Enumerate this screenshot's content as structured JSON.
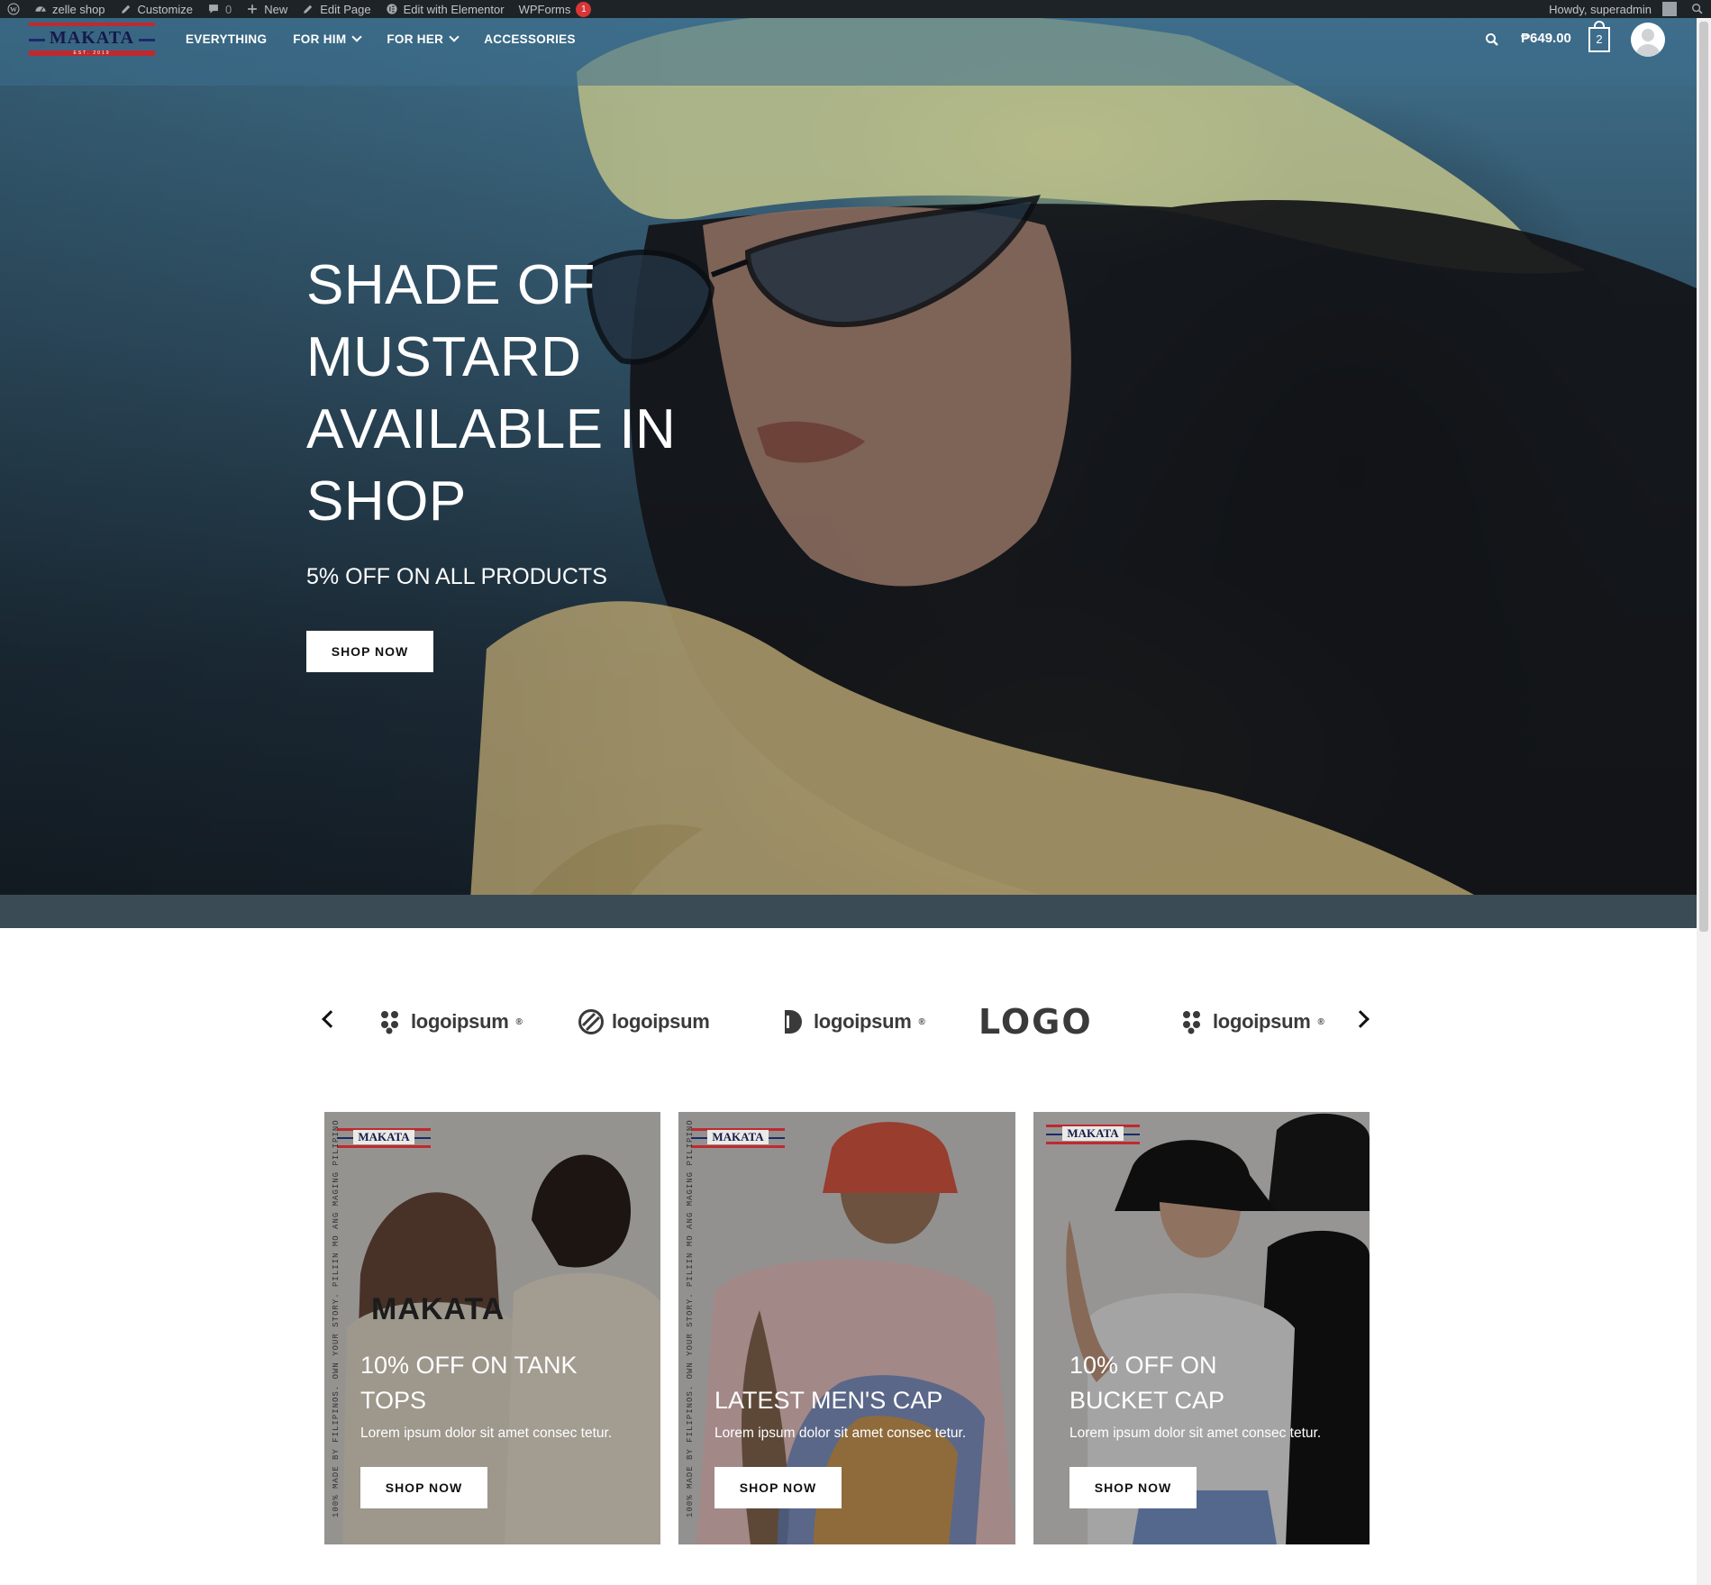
{
  "admin_bar": {
    "site_name": "zelle shop",
    "customize": "Customize",
    "comments_count": "0",
    "new": "New",
    "edit_page": "Edit Page",
    "edit_elementor": "Edit with Elementor",
    "wpforms": "WPForms",
    "wpforms_badge": "1",
    "howdy": "Howdy, superadmin"
  },
  "header": {
    "logo_text": "MAKATA",
    "logo_est": "EST. 2019",
    "nav": [
      {
        "label": "EVERYTHING",
        "has_dropdown": false
      },
      {
        "label": "FOR HIM",
        "has_dropdown": true
      },
      {
        "label": "FOR HER",
        "has_dropdown": true
      },
      {
        "label": "ACCESSORIES",
        "has_dropdown": false
      }
    ],
    "cart_total": "₱649.00",
    "cart_count": "2"
  },
  "hero": {
    "title": "SHADE OF MUSTARD AVAILABLE IN SHOP",
    "subtitle": "5% OFF ON ALL PRODUCTS",
    "button": "SHOP NOW"
  },
  "brands": [
    {
      "name": "logoipsum",
      "icon": "bubbles-logo-icon",
      "suffix": "®"
    },
    {
      "name": "logoipsum",
      "icon": "circle-stripes-logo-icon",
      "suffix": ""
    },
    {
      "name": "logoipsum",
      "icon": "half-circle-logo-icon",
      "suffix": "®"
    },
    {
      "name": "LOGO",
      "icon": "square-logo-icon",
      "suffix": ""
    },
    {
      "name": "logoipsum",
      "icon": "bubbles-logo-icon",
      "suffix": "®"
    }
  ],
  "cards": [
    {
      "title": "10% OFF ON TANK TOPS",
      "desc": "Lorem ipsum dolor sit amet consec tetur.",
      "button": "SHOP NOW",
      "logo": "MAKATA",
      "vertical_text": "100% MADE BY FILIPINOS. OWN YOUR STORY. PILIIN MO ANG MAGING PILIPINO",
      "shirt_text": "MAKATA"
    },
    {
      "title": "LATEST MEN'S CAP",
      "desc": "Lorem ipsum dolor sit amet consec tetur.",
      "button": "SHOP NOW",
      "logo": "MAKATA",
      "vertical_text": "100% MADE BY FILIPINOS. OWN YOUR STORY. PILIIN MO ANG MAGING PILIPINO"
    },
    {
      "title": "10% OFF ON BUCKET CAP",
      "desc": "Lorem ipsum dolor sit amet consec tetur.",
      "button": "SHOP NOW",
      "logo": "MAKATA"
    }
  ],
  "colors": {
    "admin_bar_bg": "#1d2327",
    "brand_red": "#c0292f",
    "brand_navy": "#1b2a6b",
    "badge_red": "#d63638"
  }
}
